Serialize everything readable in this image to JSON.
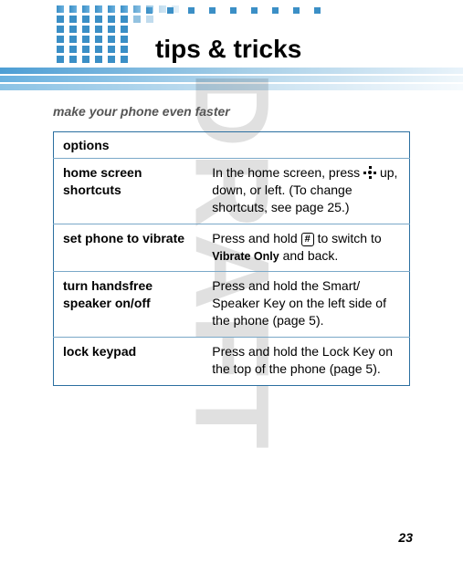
{
  "watermark": "DRAFT",
  "title": "tips & tricks",
  "subtitle": "make your phone even faster",
  "table": {
    "header": "options",
    "rows": [
      {
        "label": "home screen shortcuts",
        "desc_pre": "In the home screen, press ",
        "desc_post": " up, down, or left. (To change shortcuts, see page 25.)",
        "icon": "nav"
      },
      {
        "label": "set phone to vibrate",
        "desc_pre": "Press and hold ",
        "key": "#",
        "desc_mid": " to switch to ",
        "bold_inline": "Vibrate Only",
        "desc_post": " and back."
      },
      {
        "label": "turn handsfree speaker on/off",
        "desc_full": "Press and hold the Smart/\nSpeaker Key on the left side of the phone (page 5)."
      },
      {
        "label": "lock keypad",
        "desc_full": "Press and hold the Lock Key on the top of the phone (page 5)."
      }
    ]
  },
  "page_number": "23"
}
